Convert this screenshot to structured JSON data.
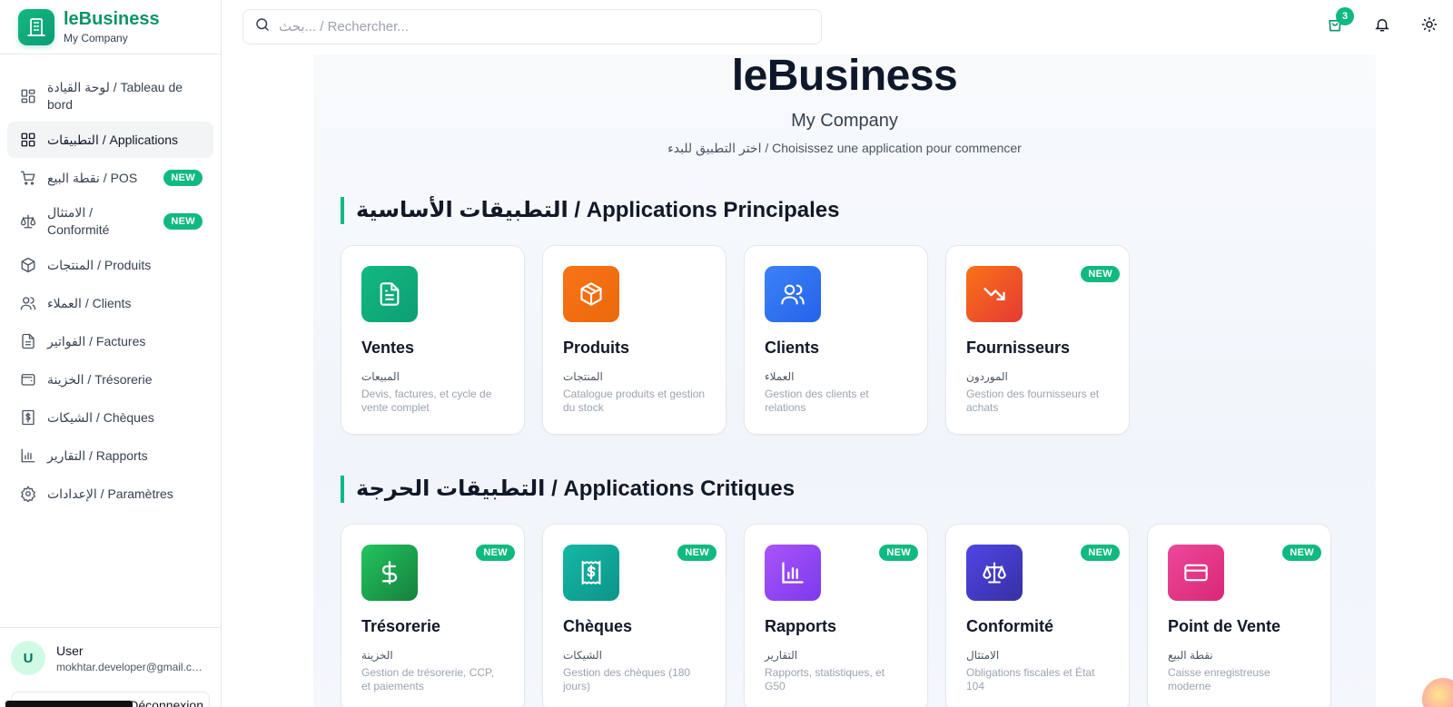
{
  "brand": {
    "title": "leBusiness",
    "subtitle": "My Company"
  },
  "search": {
    "placeholder": "بحث... / Rechercher..."
  },
  "header": {
    "cart_count": "3"
  },
  "sidebar": {
    "items": [
      {
        "label": "لوحة القيادة / Tableau de bord",
        "icon": "dashboard-icon"
      },
      {
        "label": "التطبيقات / Applications",
        "icon": "grid-icon",
        "active": true
      },
      {
        "label": "نقطة البيع / POS",
        "icon": "cart-icon",
        "badge": "NEW"
      },
      {
        "label": "الامتثال / Conformité",
        "icon": "scale-icon",
        "badge": "NEW"
      },
      {
        "label": "المنتجات / Produits",
        "icon": "package-icon"
      },
      {
        "label": "العملاء / Clients",
        "icon": "users-icon"
      },
      {
        "label": "الفواتير / Factures",
        "icon": "file-icon"
      },
      {
        "label": "الخزينة / Trésorerie",
        "icon": "wallet-icon"
      },
      {
        "label": "الشيكات / Chèques",
        "icon": "check-icon"
      },
      {
        "label": "التقارير / Rapports",
        "icon": "chart-icon"
      },
      {
        "label": "الإعدادات / Paramètres",
        "icon": "settings-icon"
      }
    ]
  },
  "user": {
    "initial": "U",
    "name": "User",
    "email": "mokhtar.developer@gmail.com",
    "logout_label": "Déconnexion"
  },
  "hero": {
    "title": "leBusiness",
    "subtitle": "My Company",
    "hint": "اختر التطبيق للبدء / Choisissez une application pour commencer"
  },
  "sections": {
    "main_title": "التطبيقات الأساسية / Applications Principales",
    "critical_title": "التطبيقات الحرجة / Applications Critiques"
  },
  "main_apps": [
    {
      "title": "Ventes",
      "ar": "المبيعات",
      "desc": "Devis, factures, et cycle de vente complet",
      "color": "#10b981",
      "icon": "document-icon"
    },
    {
      "title": "Produits",
      "ar": "المنتجات",
      "desc": "Catalogue produits et gestion du stock",
      "color": "#f97316",
      "icon": "box-icon"
    },
    {
      "title": "Clients",
      "ar": "العملاء",
      "desc": "Gestion des clients et relations",
      "color": "#3b82f6",
      "icon": "users-icon"
    },
    {
      "title": "Fournisseurs",
      "ar": "الموردون",
      "desc": "Gestion des fournisseurs et achats",
      "color": "#f4511e",
      "icon": "trend-down-icon",
      "badge": "NEW"
    }
  ],
  "critical_apps": [
    {
      "title": "Trésorerie",
      "ar": "الخزينة",
      "desc": "Gestion de trésorerie, CCP, et paiements",
      "color": "#16a34a",
      "icon": "dollar-icon",
      "badge": "NEW"
    },
    {
      "title": "Chèques",
      "ar": "الشيكات",
      "desc": "Gestion des chèques (180 jours)",
      "color": "#14b8a6",
      "icon": "receipt-icon",
      "badge": "NEW"
    },
    {
      "title": "Rapports",
      "ar": "التقارير",
      "desc": "Rapports, statistiques, et G50",
      "color": "#8b5cf6",
      "icon": "bar-chart-icon",
      "badge": "NEW"
    },
    {
      "title": "Conformité",
      "ar": "الامتثال",
      "desc": "Obligations fiscales et État 104",
      "color": "#4f46e5",
      "icon": "scale-icon",
      "badge": "NEW"
    },
    {
      "title": "Point de Vente",
      "ar": "نقطة البيع",
      "desc": "Caisse enregistreuse moderne",
      "color": "#ec4899",
      "icon": "credit-card-icon",
      "badge": "NEW"
    }
  ]
}
